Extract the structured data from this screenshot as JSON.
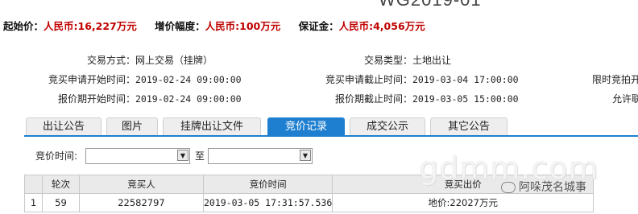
{
  "header": {
    "code": "WG2019-01",
    "start_price_label": "起始价：",
    "start_price_value": "人民币:16,227万元",
    "increment_label": "增价幅度：",
    "increment_value": "人民币:100万元",
    "deposit_label": "保证金：",
    "deposit_value": "人民币:4,056万元"
  },
  "info": {
    "trade_mode_label": "交易方式：",
    "trade_mode_value": "网上交易（挂牌）",
    "trade_type_label": "交易类型：",
    "trade_type_value": "土地出让",
    "apply_start_label": "竞买申请开始时间：",
    "apply_start_value": "2019-02-24 09:00:00",
    "apply_end_label": "竞买申请截止时间：",
    "apply_end_value": "2019-03-04 17:00:00",
    "quote_start_label": "报价期开始时间：",
    "quote_start_value": "2019-02-24 09:00:00",
    "quote_end_label": "报价期截止时间：",
    "quote_end_value": "2019-03-05 15:00:00",
    "right_col_1": "限时竞拍开",
    "right_col_2": "允许联"
  },
  "tabs": [
    {
      "label": "出让公告"
    },
    {
      "label": "图片"
    },
    {
      "label": "挂牌出让文件"
    },
    {
      "label": "竞价记录",
      "active": true
    },
    {
      "label": "成交公示"
    },
    {
      "label": "其它公告"
    }
  ],
  "filter": {
    "time_label": "竞价时间:",
    "to_label": "至"
  },
  "table": {
    "headers": [
      "",
      "轮次",
      "竞买人",
      "竞价时间",
      "竞买出价"
    ],
    "rows": [
      [
        "1",
        "59",
        "22582797",
        "2019-03-05 17:31:57.536",
        "地价:22027万元"
      ]
    ]
  },
  "watermark": {
    "site": "gdmm.com",
    "brand": "阿哚茂名城事"
  }
}
